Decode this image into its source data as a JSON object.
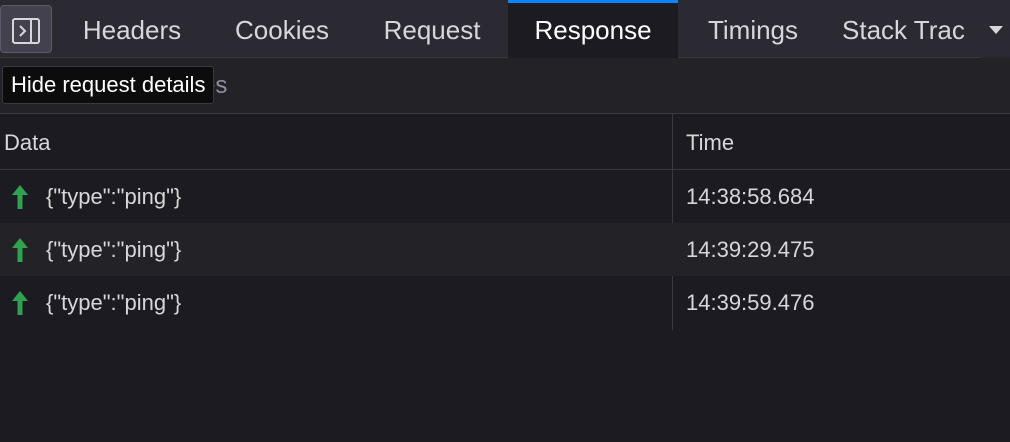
{
  "tabs": [
    {
      "label": "Headers",
      "active": false
    },
    {
      "label": "Cookies",
      "active": false
    },
    {
      "label": "Request",
      "active": false
    },
    {
      "label": "Response",
      "active": true
    },
    {
      "label": "Timings",
      "active": false
    },
    {
      "label": "Stack Trac",
      "active": false
    }
  ],
  "toolbar": {
    "toggle_icon": "sidebar-toggle-icon",
    "filter_placeholder": "Filter Messages",
    "filter_value": ""
  },
  "tooltip": "Hide request details",
  "table": {
    "columns": {
      "data": "Data",
      "time": "Time"
    },
    "rows": [
      {
        "direction": "sent",
        "data": "{\"type\":\"ping\"}",
        "time": "14:38:58.684"
      },
      {
        "direction": "sent",
        "data": "{\"type\":\"ping\"}",
        "time": "14:39:29.475"
      },
      {
        "direction": "sent",
        "data": "{\"type\":\"ping\"}",
        "time": "14:39:59.476"
      }
    ]
  },
  "colors": {
    "accent": "#0a84ff",
    "sent_arrow": "#30a14e"
  }
}
